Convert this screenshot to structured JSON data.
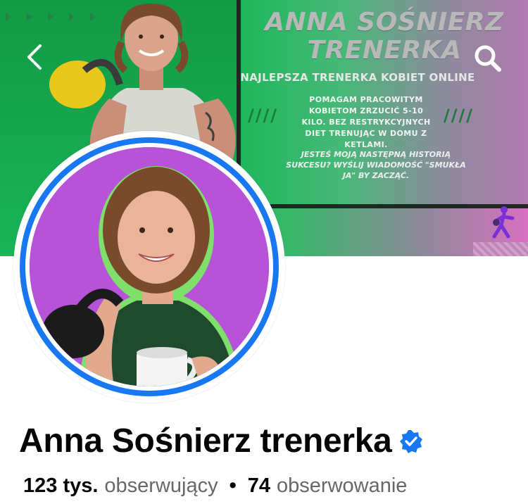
{
  "cover": {
    "title": "ANNA SOŚNIERZ\nTRENERKA",
    "subtitle": "NAJLEPSZA TRENERKA KOBIET ONLINE",
    "body": "POMAGAM PRACOWITYM KOBIETOM ZRZUCIĆ 5-10 KILO. BEZ RESTRYKCYJNYCH DIET TRENUJĄC W DOMU Z KETLAMI.",
    "cta": "JESTEŚ MOJĄ NASTĘPNĄ HISTORIĄ SUKCESU? WYŚLIJ WIADOMOŚĆ \"SMUKŁA JA\" BY ZACZĄĆ.",
    "slashes": "////"
  },
  "nav": {
    "back_icon": "chevron-left-icon",
    "search_icon": "search-icon"
  },
  "profile": {
    "name": "Anna Sośnierz trenerka",
    "verified_icon": "verified-badge-icon",
    "followers_count": "123 tys.",
    "followers_label": "obserwujący",
    "separator": "•",
    "following_count": "74",
    "following_label": "obserwowanie"
  },
  "colors": {
    "accent": "#1877f2",
    "cover_green": "#1fb85a",
    "cover_pink": "#d86fc0",
    "avatar_bg": "#b653d8",
    "text_primary": "#050505",
    "text_secondary": "#65676b"
  }
}
